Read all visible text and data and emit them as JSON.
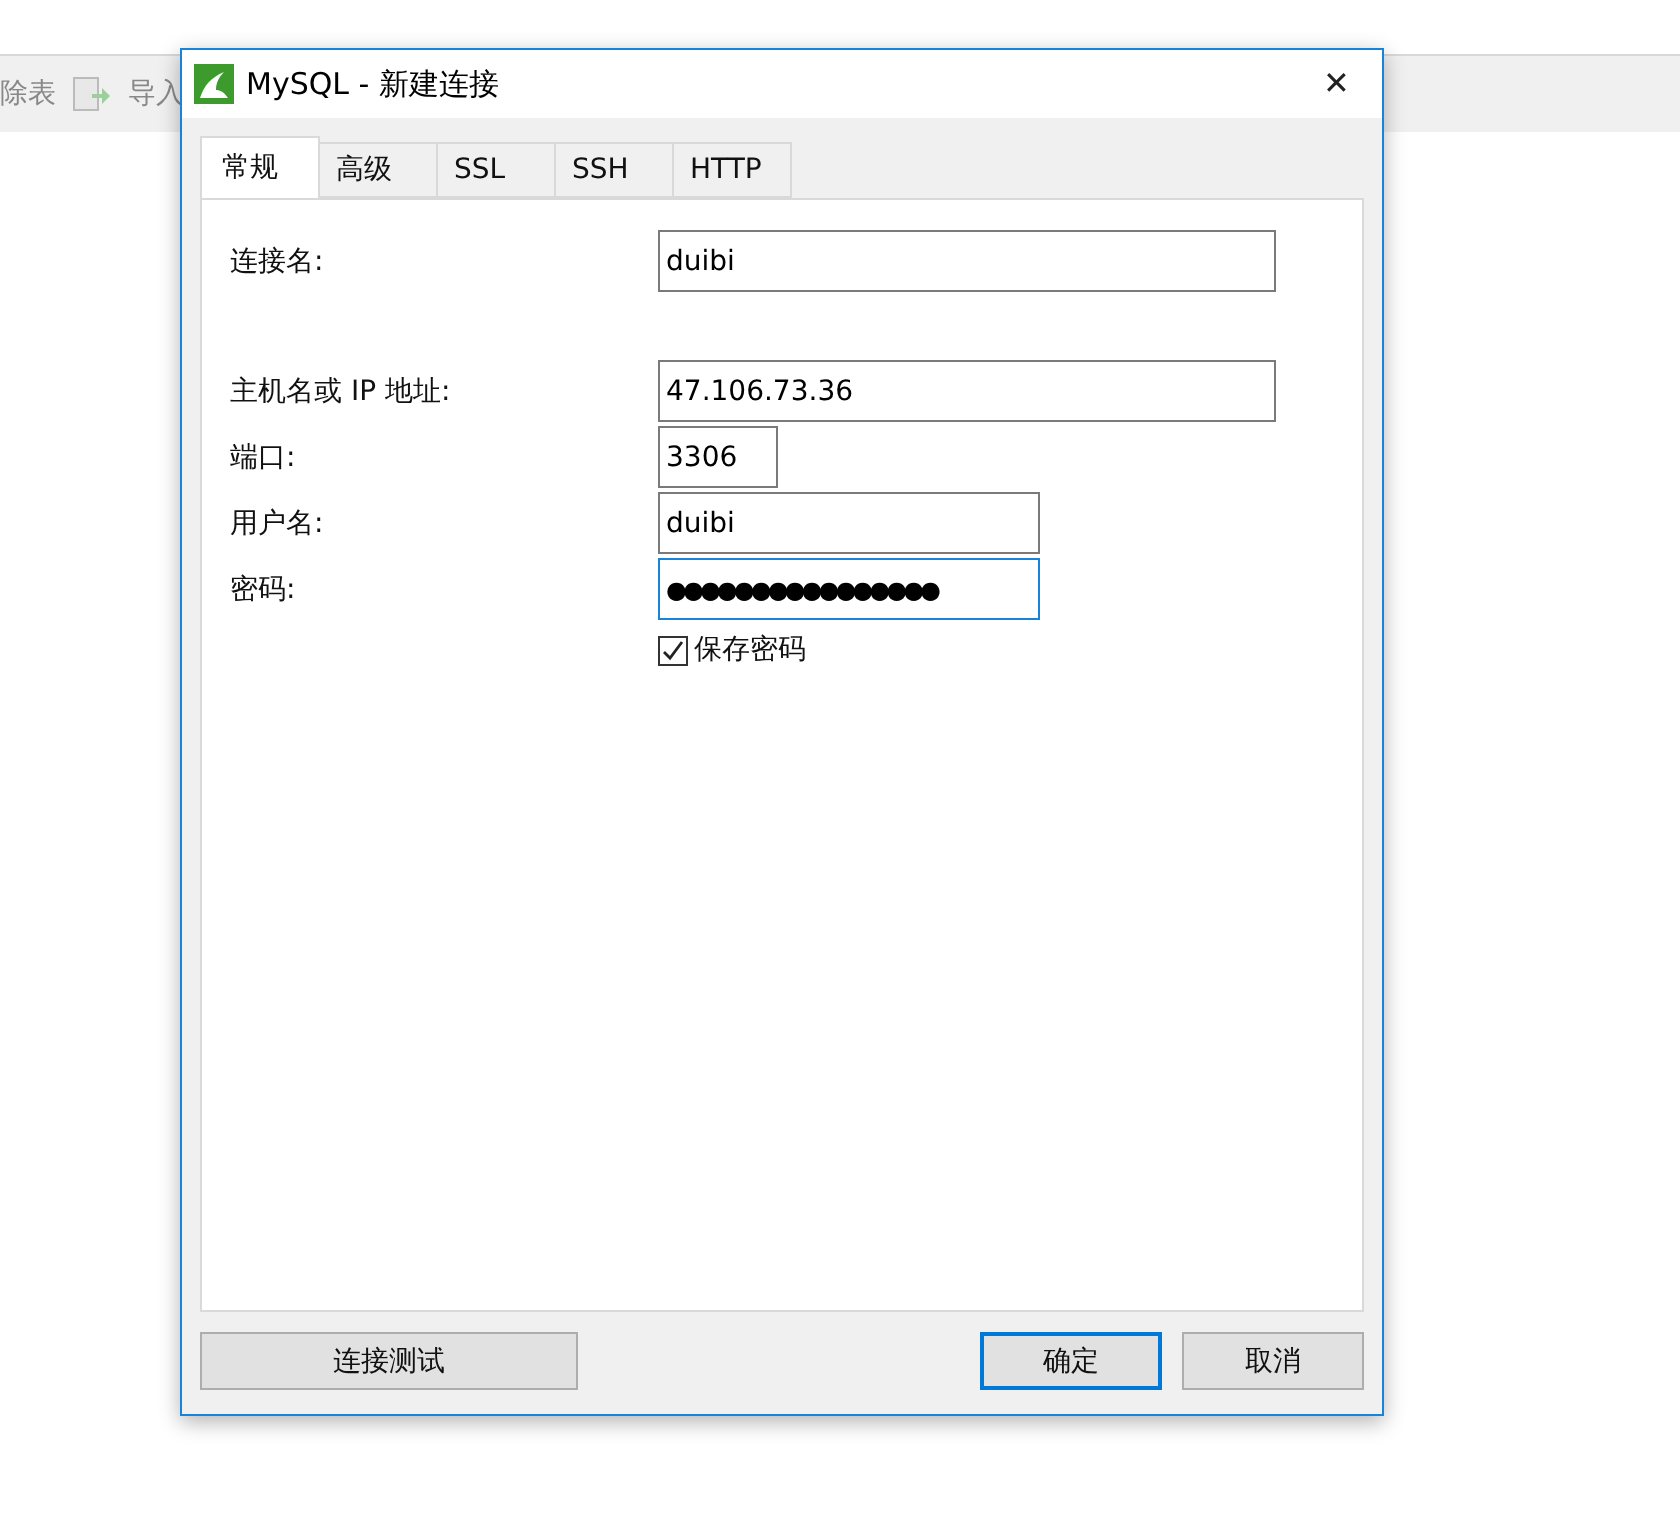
{
  "background_toolbar": {
    "items": [
      {
        "label": "除表"
      },
      {
        "label": "导入"
      }
    ]
  },
  "dialog": {
    "title": "MySQL - 新建连接",
    "close": "✕",
    "tabs": [
      {
        "label": "常规",
        "selected": true
      },
      {
        "label": "高级",
        "selected": false
      },
      {
        "label": "SSL",
        "selected": false
      },
      {
        "label": "SSH",
        "selected": false
      },
      {
        "label": "HTTP",
        "selected": false
      }
    ],
    "fields": [
      {
        "label": "连接名:",
        "value": "duibi",
        "focused": false
      },
      {
        "label": "主机名或 IP 地址:",
        "value": "47.106.73.36",
        "focused": false
      },
      {
        "label": "端口:",
        "value": "3306",
        "focused": false
      },
      {
        "label": "用户名:",
        "value": "duibi",
        "focused": false
      },
      {
        "label": "密码:",
        "value": "●●●●●●●●●●●●●●●●",
        "focused": true
      }
    ],
    "save_password": {
      "label": "保存密码",
      "checked": true
    },
    "buttons": [
      {
        "label": "连接测试",
        "default": false
      },
      {
        "label": "确定",
        "default": true
      },
      {
        "label": "取消",
        "default": false
      }
    ]
  }
}
